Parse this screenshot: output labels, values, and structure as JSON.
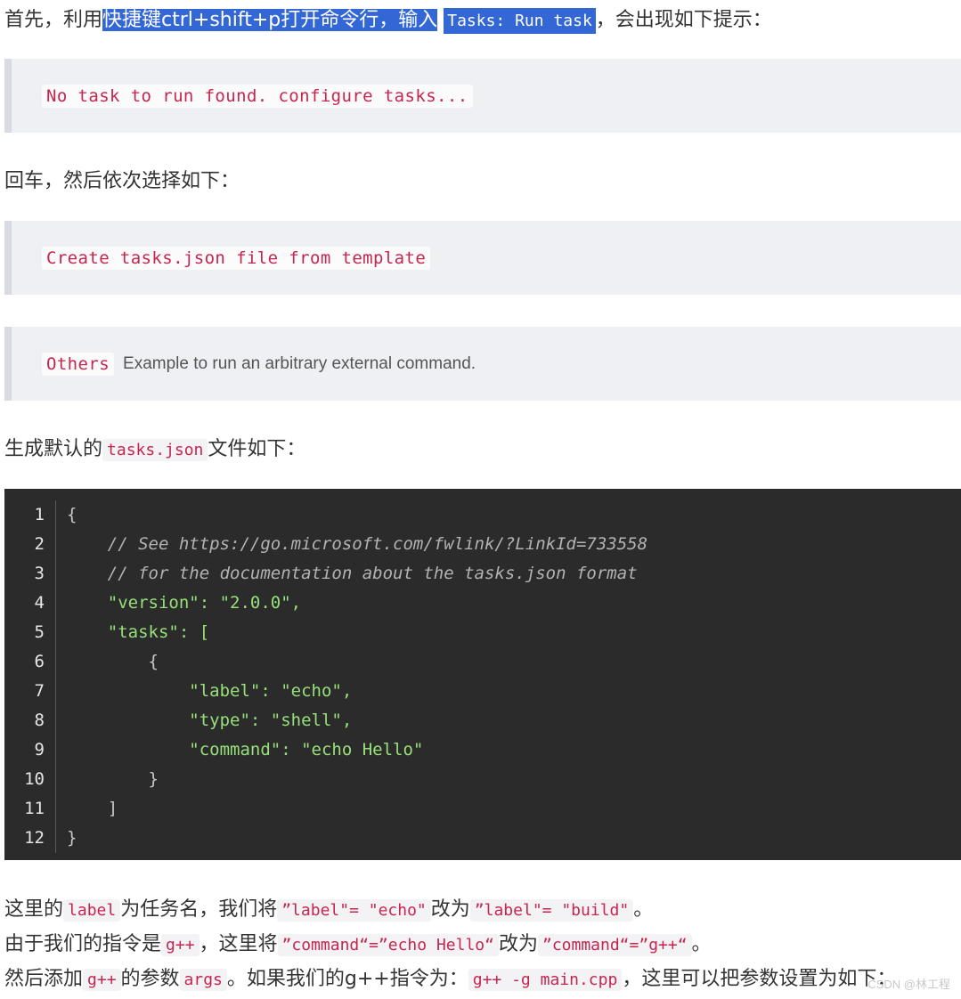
{
  "p1": {
    "t1": "首先，利用",
    "highlight": "快捷键ctrl+shift+p打开命令行，输入",
    "code": "Tasks: Run task",
    "t2": "，会出现如下提示："
  },
  "quote1": {
    "code": "No task to run found. configure tasks..."
  },
  "p2": {
    "text": "回车，然后依次选择如下："
  },
  "quote2": {
    "code": "Create tasks.json file from template"
  },
  "quote3": {
    "code": "Others",
    "desc": "Example to run an arbitrary external command."
  },
  "p3": {
    "t1": "生成默认的",
    "code": "tasks.json",
    "t2": "文件如下："
  },
  "code_block": {
    "line_numbers": [
      "1",
      "2",
      "3",
      "4",
      "5",
      "6",
      "7",
      "8",
      "9",
      "10",
      "11",
      "12"
    ],
    "lines": [
      "{",
      "    // See https://go.microsoft.com/fwlink/?LinkId=733558",
      "    // for the documentation about the tasks.json format",
      "    \"version\": \"2.0.0\",",
      "    \"tasks\": [",
      "        {",
      "            \"label\": \"echo\",",
      "            \"type\": \"shell\",",
      "            \"command\": \"echo Hello\"",
      "        }",
      "    ]",
      "}"
    ]
  },
  "p4": {
    "t1": "这里的",
    "c1": "label",
    "t2": "为任务名，我们将",
    "c2": "”label\"= \"echo\"",
    "t3": "改为",
    "c3": "”label\"= \"build\"",
    "t4": "。"
  },
  "p5": {
    "t1": "由于我们的指令是",
    "c1": "g++",
    "t2": "，这里将",
    "c2": "”command“=”echo Hello“",
    "t3": "改为",
    "c3": "”command“=”g++“",
    "t4": "。"
  },
  "p6": {
    "t1": "然后添加",
    "c1": "g++",
    "t2": "的参数",
    "c2": "args",
    "t3": "。如果我们的g++指令为：",
    "c3": "g++ -g main.cpp",
    "t4": "，这里可以把参数设置为如下："
  },
  "watermark": "CSDN @林工程"
}
